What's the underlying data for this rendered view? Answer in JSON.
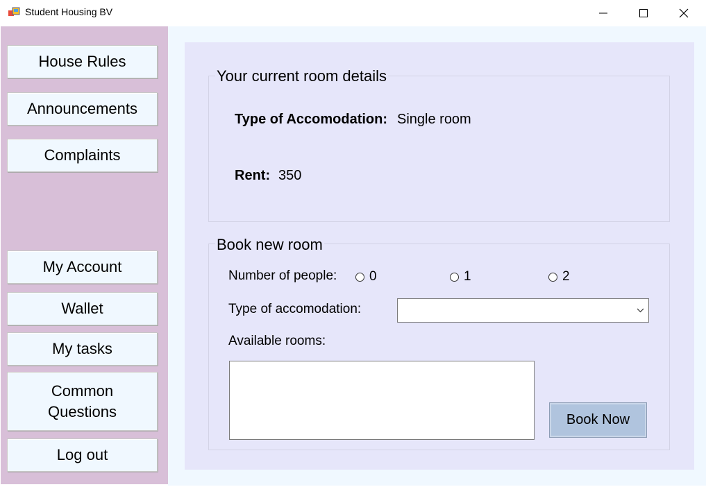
{
  "window": {
    "title": "Student Housing BV"
  },
  "sidebar": {
    "buttons": [
      {
        "label": "House Rules"
      },
      {
        "label": "Announcements"
      },
      {
        "label": "Complaints"
      },
      {
        "label": "My Account"
      },
      {
        "label": "Wallet"
      },
      {
        "label": "My tasks"
      },
      {
        "label": "Common\nQuestions"
      },
      {
        "label": "Log out"
      }
    ]
  },
  "current_room": {
    "title": "Your current room details",
    "type_label": "Type of Accomodation:",
    "type_value": "Single room",
    "rent_label": "Rent:",
    "rent_value": "350"
  },
  "book_room": {
    "title": "Book new room",
    "people_label": "Number of people:",
    "people_options": [
      "0",
      "1",
      "2"
    ],
    "type_label": "Type of accomodation:",
    "type_selected": "",
    "available_label": "Available rooms:",
    "book_button": "Book Now"
  },
  "colors": {
    "sidebar_bg": "#d8bfd8",
    "panel_bg": "#e6e6fa",
    "content_bg": "#f0f8ff",
    "book_button_bg": "#b0c4de"
  }
}
